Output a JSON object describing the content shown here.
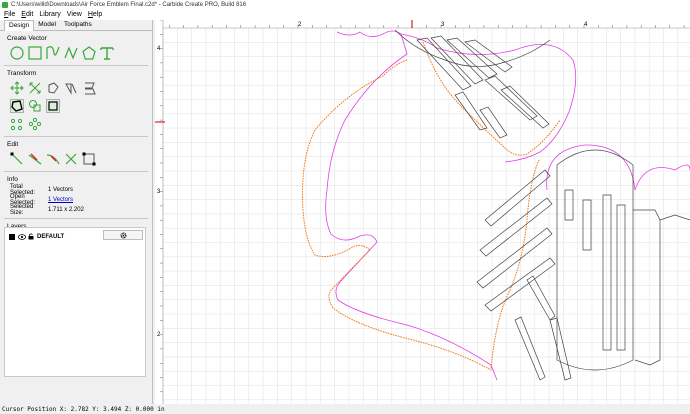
{
  "window": {
    "title": "C:\\Users\\willd\\Downloads\\Air Force Emblem Final.c2d* - Carbide Create PRO, Build 816"
  },
  "menu": {
    "items": [
      {
        "underline": "F",
        "rest": "ile"
      },
      {
        "underline": "E",
        "rest": "dit"
      },
      {
        "underline": "",
        "rest": "Library"
      },
      {
        "underline": "",
        "rest": "View"
      },
      {
        "underline": "H",
        "rest": "elp"
      }
    ]
  },
  "tabs": [
    {
      "label": "Design",
      "active": true
    },
    {
      "label": "Model",
      "active": false
    },
    {
      "label": "Toolpaths",
      "active": false
    }
  ],
  "sections": {
    "create_vector": "Create Vector",
    "transform": "Transform",
    "edit": "Edit",
    "info": "Info",
    "layers": "Layers"
  },
  "info": {
    "total_selected_label": "Total Selected:",
    "total_selected_value": "1 Vectors",
    "open_selected_label": "Open Selected:",
    "open_selected_value": "1 Vectors",
    "selected_size_label": "Selected Size:",
    "selected_size_value": "1.711 x 2.202"
  },
  "layers": {
    "default_name": "DEFAULT"
  },
  "rulers": {
    "top_labels": [
      "2",
      "3",
      "4"
    ],
    "left_labels": [
      "4",
      "3",
      "2"
    ]
  },
  "status": {
    "text": "Cursor Position X: 2.782 Y: 3.494 Z: 0.000 in"
  },
  "colors": {
    "accent_green": "#3aa83a",
    "selected_orange": "#f07a1a",
    "offset_magenta": "#e63ce6",
    "ruler_red": "#e02020"
  }
}
